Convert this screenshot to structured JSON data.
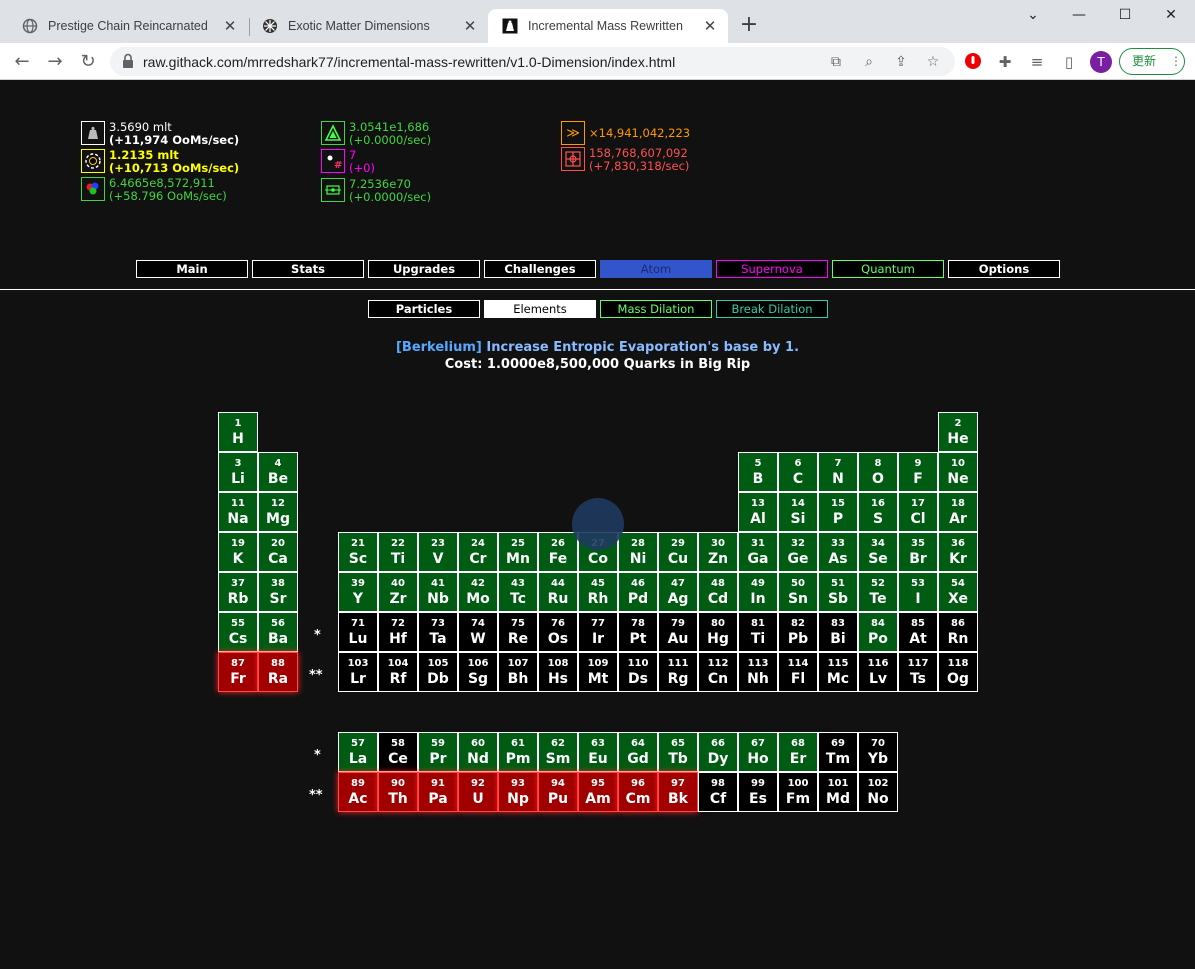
{
  "browser": {
    "tabs": [
      {
        "title": "Prestige Chain Reincarnated"
      },
      {
        "title": "Exotic Matter Dimensions"
      },
      {
        "title": "Incremental Mass Rewritten"
      }
    ],
    "url": "raw.githack.com/mrredshark77/incremental-mass-rewritten/v1.0-Dimension/index.html",
    "profile_initial": "T",
    "update_label": "更新"
  },
  "resources": {
    "mass": {
      "value": "3.5690 mlt",
      "rate": "(+11,974 OoMs/sec)",
      "icon": "mass-icon",
      "color": "#ffffff"
    },
    "black_hole": {
      "value": "1.2135 mlt",
      "rate": "(+10,713 OoMs/sec)",
      "icon": "black-hole-icon",
      "color": "#ffff00"
    },
    "atom": {
      "value": "6.4665e8,572,911",
      "rate": "(+58.796 OoMs/sec)",
      "icon": "atom-icon",
      "color": "#42d442"
    },
    "dilated_mass": {
      "value": "3.0541e1,686",
      "rate": "(+0.0000/sec)",
      "icon": "dilated-mass-icon",
      "color": "#42d442"
    },
    "supernova": {
      "value": "7",
      "rate": "(+0)",
      "icon": "supernova-icon",
      "color": "#ff00ff"
    },
    "quantum": {
      "value": "7.2536e70",
      "rate": "(+0.0000/sec)",
      "icon": "quantum-icon",
      "color": "#42d442"
    },
    "rage": {
      "value": "×14,941,042,223",
      "icon": "rage-icon",
      "color": "#ff9900"
    },
    "dark": {
      "value": "158,768,607,092",
      "rate": "(+7,830,318/sec)",
      "icon": "dark-icon",
      "color": "#ff5050"
    }
  },
  "main_tabs": [
    {
      "label": "Main",
      "color": "#ffffff",
      "bg": "#000000",
      "border": "#ffffff"
    },
    {
      "label": "Stats",
      "color": "#ffffff",
      "bg": "#000000",
      "border": "#ffffff"
    },
    {
      "label": "Upgrades",
      "color": "#ffffff",
      "bg": "#000000",
      "border": "#ffffff"
    },
    {
      "label": "Challenges",
      "color": "#ffffff",
      "bg": "#000000",
      "border": "#ffffff"
    },
    {
      "label": "Atom",
      "color": "#1a2b6e",
      "bg": "#3355cc",
      "border": "#3355cc"
    },
    {
      "label": "Supernova",
      "color": "#ff00ff",
      "bg": "#000000",
      "border": "#ff00ff"
    },
    {
      "label": "Quantum",
      "color": "#66ff66",
      "bg": "#000000",
      "border": "#66ff66"
    },
    {
      "label": "Options",
      "color": "#ffffff",
      "bg": "#000000",
      "border": "#ffffff"
    }
  ],
  "sub_tabs": [
    {
      "label": "Particles",
      "color": "#ffffff",
      "bg": "#000000",
      "border": "#ffffff",
      "weight": "bold"
    },
    {
      "label": "Elements",
      "color": "#000000",
      "bg": "#ffffff",
      "border": "#ffffff",
      "weight": "normal"
    },
    {
      "label": "Mass Dilation",
      "color": "#66ff66",
      "bg": "#000000",
      "border": "#66ff66",
      "weight": "normal"
    },
    {
      "label": "Break Dilation",
      "color": "#33ccaa",
      "bg": "#000000",
      "border": "#33ccaa",
      "weight": "normal"
    }
  ],
  "element_info": {
    "name": "[Berkelium]",
    "description": "Increase Entropic Evaporation's base by 1.",
    "cost": "Cost: 1.0000e8,500,000 Quarks in Big Rip",
    "name_color": "#55aaff",
    "desc_color": "#88bbff"
  },
  "markers": {
    "lanthanide": "*",
    "actinide": "**"
  },
  "elements": [
    {
      "n": "1",
      "s": "H",
      "st": "g"
    },
    {
      "n": "2",
      "s": "He",
      "st": "g"
    },
    {
      "n": "3",
      "s": "Li",
      "st": "g"
    },
    {
      "n": "4",
      "s": "Be",
      "st": "g"
    },
    {
      "n": "5",
      "s": "B",
      "st": "g"
    },
    {
      "n": "6",
      "s": "C",
      "st": "g"
    },
    {
      "n": "7",
      "s": "N",
      "st": "g"
    },
    {
      "n": "8",
      "s": "O",
      "st": "g"
    },
    {
      "n": "9",
      "s": "F",
      "st": "g"
    },
    {
      "n": "10",
      "s": "Ne",
      "st": "g"
    },
    {
      "n": "11",
      "s": "Na",
      "st": "g"
    },
    {
      "n": "12",
      "s": "Mg",
      "st": "g"
    },
    {
      "n": "13",
      "s": "Al",
      "st": "g"
    },
    {
      "n": "14",
      "s": "Si",
      "st": "g"
    },
    {
      "n": "15",
      "s": "P",
      "st": "g"
    },
    {
      "n": "16",
      "s": "S",
      "st": "g"
    },
    {
      "n": "17",
      "s": "Cl",
      "st": "g"
    },
    {
      "n": "18",
      "s": "Ar",
      "st": "g"
    },
    {
      "n": "19",
      "s": "K",
      "st": "g"
    },
    {
      "n": "20",
      "s": "Ca",
      "st": "g"
    },
    {
      "n": "21",
      "s": "Sc",
      "st": "g"
    },
    {
      "n": "22",
      "s": "Ti",
      "st": "g"
    },
    {
      "n": "23",
      "s": "V",
      "st": "g"
    },
    {
      "n": "24",
      "s": "Cr",
      "st": "g"
    },
    {
      "n": "25",
      "s": "Mn",
      "st": "g"
    },
    {
      "n": "26",
      "s": "Fe",
      "st": "g"
    },
    {
      "n": "27",
      "s": "Co",
      "st": "g"
    },
    {
      "n": "28",
      "s": "Ni",
      "st": "g"
    },
    {
      "n": "29",
      "s": "Cu",
      "st": "g"
    },
    {
      "n": "30",
      "s": "Zn",
      "st": "g"
    },
    {
      "n": "31",
      "s": "Ga",
      "st": "g"
    },
    {
      "n": "32",
      "s": "Ge",
      "st": "g"
    },
    {
      "n": "33",
      "s": "As",
      "st": "g"
    },
    {
      "n": "34",
      "s": "Se",
      "st": "g"
    },
    {
      "n": "35",
      "s": "Br",
      "st": "g"
    },
    {
      "n": "36",
      "s": "Kr",
      "st": "g"
    },
    {
      "n": "37",
      "s": "Rb",
      "st": "g"
    },
    {
      "n": "38",
      "s": "Sr",
      "st": "g"
    },
    {
      "n": "39",
      "s": "Y",
      "st": "g"
    },
    {
      "n": "40",
      "s": "Zr",
      "st": "g"
    },
    {
      "n": "41",
      "s": "Nb",
      "st": "g"
    },
    {
      "n": "42",
      "s": "Mo",
      "st": "g"
    },
    {
      "n": "43",
      "s": "Tc",
      "st": "g"
    },
    {
      "n": "44",
      "s": "Ru",
      "st": "g"
    },
    {
      "n": "45",
      "s": "Rh",
      "st": "g"
    },
    {
      "n": "46",
      "s": "Pd",
      "st": "g"
    },
    {
      "n": "47",
      "s": "Ag",
      "st": "g"
    },
    {
      "n": "48",
      "s": "Cd",
      "st": "g"
    },
    {
      "n": "49",
      "s": "In",
      "st": "g"
    },
    {
      "n": "50",
      "s": "Sn",
      "st": "g"
    },
    {
      "n": "51",
      "s": "Sb",
      "st": "g"
    },
    {
      "n": "52",
      "s": "Te",
      "st": "g"
    },
    {
      "n": "53",
      "s": "I",
      "st": "g"
    },
    {
      "n": "54",
      "s": "Xe",
      "st": "g"
    },
    {
      "n": "55",
      "s": "Cs",
      "st": "g"
    },
    {
      "n": "56",
      "s": "Ba",
      "st": "g"
    },
    {
      "n": "71",
      "s": "Lu",
      "st": "b"
    },
    {
      "n": "72",
      "s": "Hf",
      "st": "b"
    },
    {
      "n": "73",
      "s": "Ta",
      "st": "b"
    },
    {
      "n": "74",
      "s": "W",
      "st": "b"
    },
    {
      "n": "75",
      "s": "Re",
      "st": "b"
    },
    {
      "n": "76",
      "s": "Os",
      "st": "b"
    },
    {
      "n": "77",
      "s": "Ir",
      "st": "b"
    },
    {
      "n": "78",
      "s": "Pt",
      "st": "b"
    },
    {
      "n": "79",
      "s": "Au",
      "st": "b"
    },
    {
      "n": "80",
      "s": "Hg",
      "st": "b"
    },
    {
      "n": "81",
      "s": "Ti",
      "st": "b"
    },
    {
      "n": "82",
      "s": "Pb",
      "st": "b"
    },
    {
      "n": "83",
      "s": "Bi",
      "st": "b"
    },
    {
      "n": "84",
      "s": "Po",
      "st": "g"
    },
    {
      "n": "85",
      "s": "At",
      "st": "b"
    },
    {
      "n": "86",
      "s": "Rn",
      "st": "b"
    },
    {
      "n": "87",
      "s": "Fr",
      "st": "r"
    },
    {
      "n": "88",
      "s": "Ra",
      "st": "r"
    },
    {
      "n": "103",
      "s": "Lr",
      "st": "b"
    },
    {
      "n": "104",
      "s": "Rf",
      "st": "b"
    },
    {
      "n": "105",
      "s": "Db",
      "st": "b"
    },
    {
      "n": "106",
      "s": "Sg",
      "st": "b"
    },
    {
      "n": "107",
      "s": "Bh",
      "st": "b"
    },
    {
      "n": "108",
      "s": "Hs",
      "st": "b"
    },
    {
      "n": "109",
      "s": "Mt",
      "st": "b"
    },
    {
      "n": "110",
      "s": "Ds",
      "st": "b"
    },
    {
      "n": "111",
      "s": "Rg",
      "st": "b"
    },
    {
      "n": "112",
      "s": "Cn",
      "st": "b"
    },
    {
      "n": "113",
      "s": "Nh",
      "st": "b"
    },
    {
      "n": "114",
      "s": "Fl",
      "st": "b"
    },
    {
      "n": "115",
      "s": "Mc",
      "st": "b"
    },
    {
      "n": "116",
      "s": "Lv",
      "st": "b"
    },
    {
      "n": "117",
      "s": "Ts",
      "st": "b"
    },
    {
      "n": "118",
      "s": "Og",
      "st": "b"
    },
    {
      "n": "57",
      "s": "La",
      "st": "g"
    },
    {
      "n": "58",
      "s": "Ce",
      "st": "b"
    },
    {
      "n": "59",
      "s": "Pr",
      "st": "g"
    },
    {
      "n": "60",
      "s": "Nd",
      "st": "g"
    },
    {
      "n": "61",
      "s": "Pm",
      "st": "g"
    },
    {
      "n": "62",
      "s": "Sm",
      "st": "g"
    },
    {
      "n": "63",
      "s": "Eu",
      "st": "g"
    },
    {
      "n": "64",
      "s": "Gd",
      "st": "g"
    },
    {
      "n": "65",
      "s": "Tb",
      "st": "g"
    },
    {
      "n": "66",
      "s": "Dy",
      "st": "g"
    },
    {
      "n": "67",
      "s": "Ho",
      "st": "g"
    },
    {
      "n": "68",
      "s": "Er",
      "st": "g"
    },
    {
      "n": "69",
      "s": "Tm",
      "st": "b"
    },
    {
      "n": "70",
      "s": "Yb",
      "st": "b"
    },
    {
      "n": "89",
      "s": "Ac",
      "st": "r"
    },
    {
      "n": "90",
      "s": "Th",
      "st": "r"
    },
    {
      "n": "91",
      "s": "Pa",
      "st": "r"
    },
    {
      "n": "92",
      "s": "U",
      "st": "r"
    },
    {
      "n": "93",
      "s": "Np",
      "st": "r"
    },
    {
      "n": "94",
      "s": "Pu",
      "st": "r"
    },
    {
      "n": "95",
      "s": "Am",
      "st": "r"
    },
    {
      "n": "96",
      "s": "Cm",
      "st": "r"
    },
    {
      "n": "97",
      "s": "Bk",
      "st": "r"
    },
    {
      "n": "98",
      "s": "Cf",
      "st": "b"
    },
    {
      "n": "99",
      "s": "Es",
      "st": "b"
    },
    {
      "n": "100",
      "s": "Fm",
      "st": "b"
    },
    {
      "n": "101",
      "s": "Md",
      "st": "b"
    },
    {
      "n": "102",
      "s": "No",
      "st": "b"
    }
  ]
}
